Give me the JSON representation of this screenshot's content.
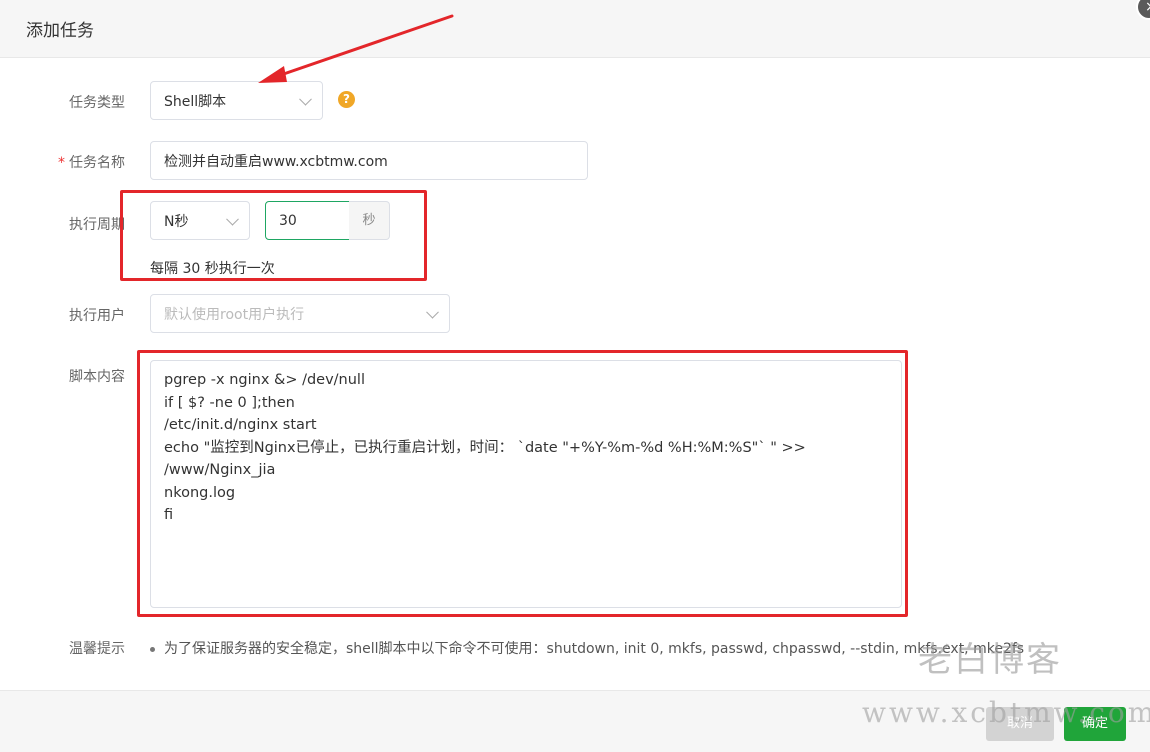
{
  "dialog": {
    "title": "添加任务"
  },
  "form": {
    "task_type": {
      "label": "任务类型",
      "value": "Shell脚本",
      "help": "?"
    },
    "task_name": {
      "required_mark": "*",
      "label": "任务名称",
      "value": "检测并自动重启www.xcbtmw.com"
    },
    "period": {
      "label": "执行周期",
      "type_value": "N秒",
      "number_value": "30",
      "unit": "秒",
      "description": "每隔 30 秒执行一次"
    },
    "run_user": {
      "label": "执行用户",
      "placeholder": "默认使用root用户执行"
    },
    "script": {
      "label": "脚本内容",
      "content": "pgrep -x nginx &> /dev/null\nif [ $? -ne 0 ];then\n/etc/init.d/nginx start\necho \"监控到Nginx已停止，已执行重启计划，时间： `date \"+%Y-%m-%d %H:%M:%S\"` \" >> /www/Nginx_jia\nnkong.log\nfi"
    },
    "tip": {
      "label": "温馨提示",
      "text": "为了保证服务器的安全稳定，shell脚本中以下命令不可使用：shutdown, init 0, mkfs, passwd, chpasswd, --stdin, mkfs.ext, mke2fs"
    }
  },
  "footer": {
    "cancel_label": "取消",
    "ok_label": "确定"
  },
  "watermark": {
    "line1": "老白博客",
    "line2": "www.xcbtmw.com"
  },
  "colors": {
    "accent": "#20a53a",
    "annotation": "#e3262a",
    "help": "#f0a727"
  }
}
